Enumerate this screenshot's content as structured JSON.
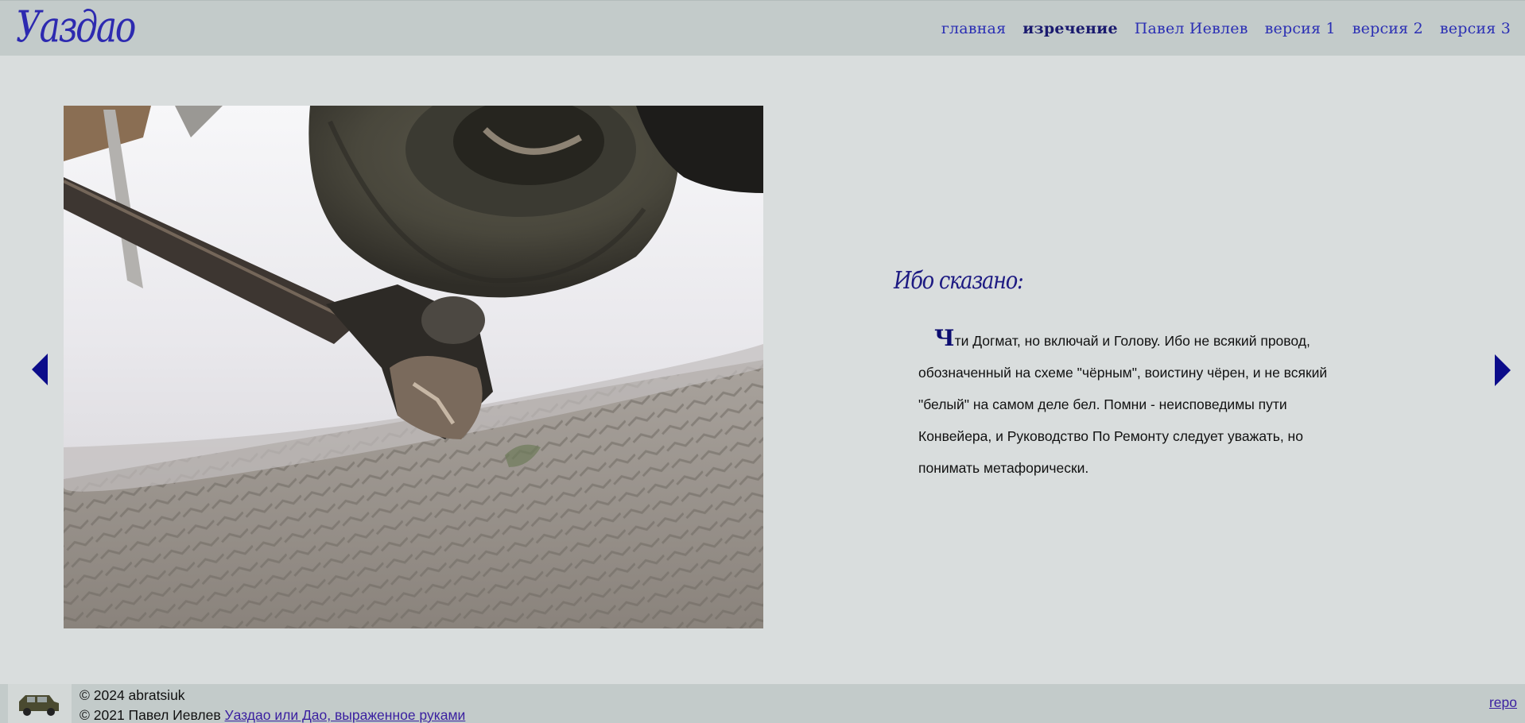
{
  "header": {
    "logo": "Уаздао",
    "nav": [
      {
        "label": "главная",
        "active": false
      },
      {
        "label": "изречение",
        "active": true
      },
      {
        "label": "Павел Иевлев",
        "active": false
      },
      {
        "label": "версия 1",
        "active": false
      },
      {
        "label": "версия 2",
        "active": false
      },
      {
        "label": "версия 3",
        "active": false
      }
    ]
  },
  "main": {
    "quote_title": "Ибо сказано:",
    "dropcap": "Ч",
    "quote_text": "ти Догмат, но включай и Голову. Ибо не всякий провод, обозначенный на схеме \"чёрным\", воистину чёрен, и не всякий \"белый\" на самом деле бел. Помни - неисповедимы пути Конвейера, и Руководство По Ремонту следует уважать, но понимать метафорически."
  },
  "footer": {
    "line1": "© 2024 abratsiuk",
    "line2_prefix": "© 2021 Павел Иевлев ",
    "line2_link": "Уаздао или Дао, выраженное руками",
    "repo": "repo"
  },
  "colors": {
    "accent": "#2b2fb4",
    "arrow": "#0c0c8a",
    "header_bg": "#c3cbca",
    "page_bg": "#d9dddd"
  }
}
